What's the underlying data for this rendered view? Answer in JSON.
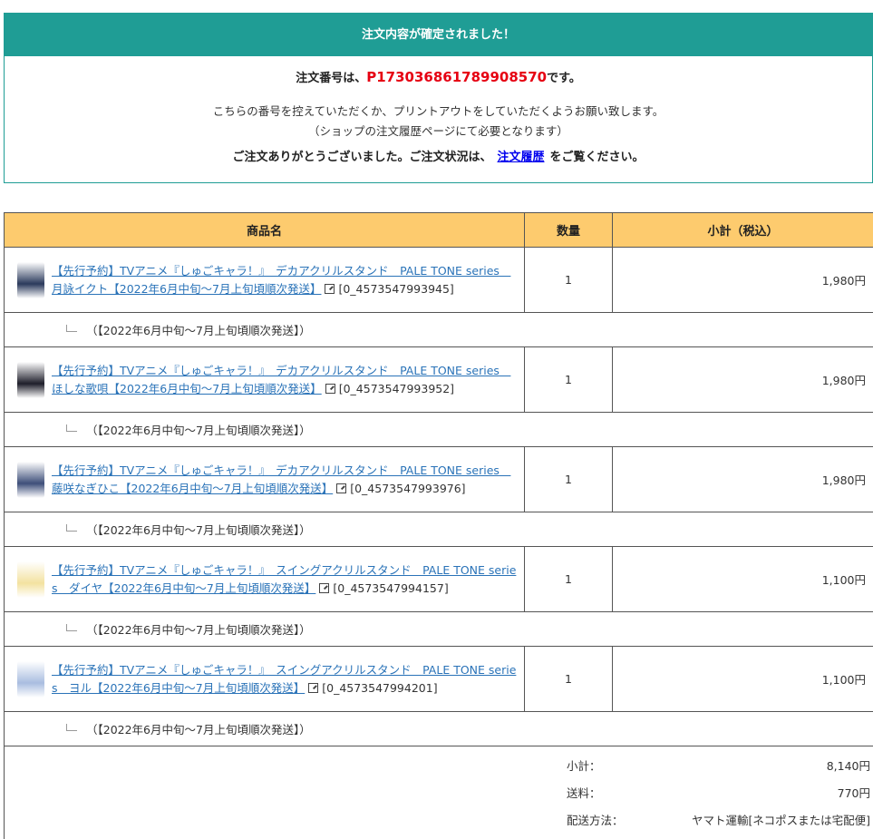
{
  "confirm": {
    "header": "注文内容が確定されました！",
    "order_prefix": "注文番号は、",
    "order_number": "P173036861789908570",
    "order_suffix": "です。",
    "keep_text": "こちらの番号を控えていただくか、プリントアウトをしていただくようお願い致します。",
    "required_text": "（ショップの注文履歴ページにて必要となります）",
    "thanks_prefix": "ご注文ありがとうございました。ご注文状況は、",
    "history_link": "注文履歴",
    "thanks_suffix": "をご覧ください。"
  },
  "table": {
    "headers": {
      "name": "商品名",
      "qty": "数量",
      "subtotal": "小計（税込）"
    },
    "items": [
      {
        "title": "【先行予約】TVアニメ『しゅごキャラ！』　デカアクリルスタンド　PALE TONE series　月詠イクト【2022年6月中旬～7月上旬頃順次発送】",
        "code": "[0_4573547993945]",
        "qty": "1",
        "subtotal": "1,980円",
        "note": "（【2022年6月中旬～7月上旬頃順次発送】）",
        "thumb_color": "#2b3a5c"
      },
      {
        "title": "【先行予約】TVアニメ『しゅごキャラ！』　デカアクリルスタンド　PALE TONE series　ほしな歌唄【2022年6月中旬～7月上旬頃順次発送】",
        "code": "[0_4573547993952]",
        "qty": "1",
        "subtotal": "1,980円",
        "note": "（【2022年6月中旬～7月上旬頃順次発送】）",
        "thumb_color": "#1e1e2a"
      },
      {
        "title": "【先行予約】TVアニメ『しゅごキャラ！』　デカアクリルスタンド　PALE TONE series　藤咲なぎひこ【2022年6月中旬～7月上旬頃順次発送】",
        "code": "[0_4573547993976]",
        "qty": "1",
        "subtotal": "1,980円",
        "note": "（【2022年6月中旬～7月上旬頃順次発送】）",
        "thumb_color": "#3e4f7a"
      },
      {
        "title": "【先行予約】TVアニメ『しゅごキャラ！』　スイングアクリルスタンド　PALE TONE series　ダイヤ【2022年6月中旬～7月上旬頃順次発送】",
        "code": "[0_4573547994157]",
        "qty": "1",
        "subtotal": "1,100円",
        "note": "（【2022年6月中旬～7月上旬頃順次発送】）",
        "thumb_color": "#f3e2a0"
      },
      {
        "title": "【先行予約】TVアニメ『しゅごキャラ！』　スイングアクリルスタンド　PALE TONE series　ヨル【2022年6月中旬～7月上旬頃順次発送】",
        "code": "[0_4573547994201]",
        "qty": "1",
        "subtotal": "1,100円",
        "note": "（【2022年6月中旬～7月上旬頃順次発送】）",
        "thumb_color": "#a9bde0"
      }
    ]
  },
  "summary": {
    "subtotal_label": "小計：",
    "subtotal_value": "8,140円",
    "shipping_label": "送料：",
    "shipping_value": "770円",
    "method_label": "配送方法：",
    "method_value": "ヤマト運輸[ネコポスまたは宅配便]"
  },
  "colors": {
    "header_bg": "#1f9d95",
    "order_number": "#e60012",
    "table_header_bg": "#fdcb6e",
    "link": "#2a73b8"
  }
}
